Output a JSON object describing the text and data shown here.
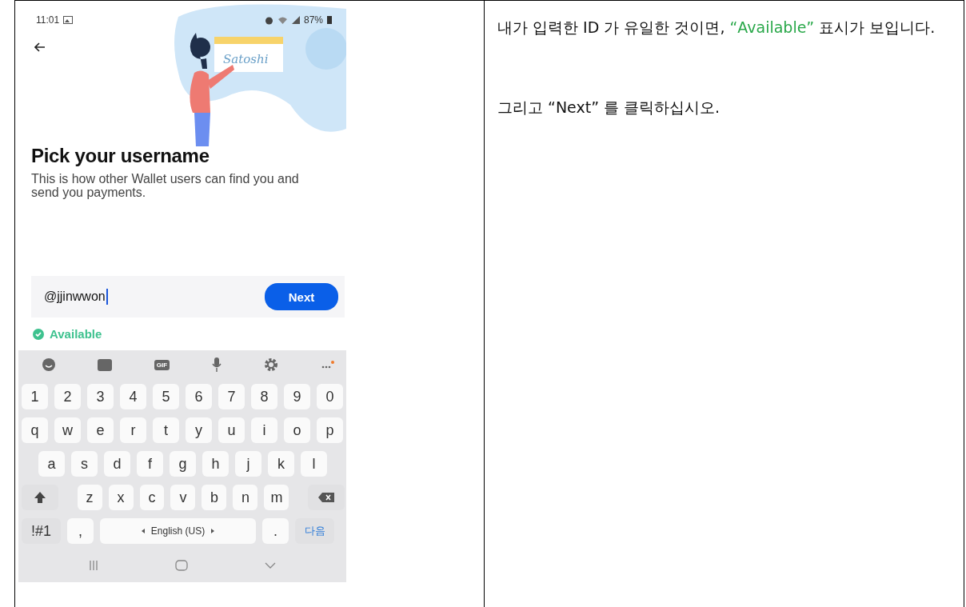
{
  "phone": {
    "status_bar": {
      "time": "11:01",
      "battery": "87%"
    },
    "illustration": {
      "sign_label": "Satoshi"
    },
    "title": "Pick your username",
    "subtitle": "This is how other Wallet users can find you and send you payments.",
    "username_field": {
      "value": "@jjinwwon"
    },
    "next_button": "Next",
    "availability": {
      "available": true,
      "label": "Available"
    },
    "keyboard": {
      "gif_label": "GIF",
      "rows": [
        [
          "1",
          "2",
          "3",
          "4",
          "5",
          "6",
          "7",
          "8",
          "9",
          "0"
        ],
        [
          "q",
          "w",
          "e",
          "r",
          "t",
          "y",
          "u",
          "i",
          "o",
          "p"
        ],
        [
          "a",
          "s",
          "d",
          "f",
          "g",
          "h",
          "j",
          "k",
          "l"
        ],
        [
          "z",
          "x",
          "c",
          "v",
          "b",
          "n",
          "m"
        ]
      ],
      "symbols_key": "!#1",
      "comma_key": ",",
      "space_key": "English (US)",
      "period_key": ".",
      "action_key": "다음"
    }
  },
  "instructions": {
    "paragraphs": [
      [
        {
          "text": "내가 입력한 ID 가 유일한 것이면, ",
          "highlight": false
        },
        {
          "text": "“Available”",
          "highlight": true
        },
        {
          "text": " 표시가 보입니다.",
          "highlight": false
        }
      ],
      [
        {
          "text": "그리고 “Next” 를 클릭하십시오.",
          "highlight": false
        }
      ]
    ]
  }
}
